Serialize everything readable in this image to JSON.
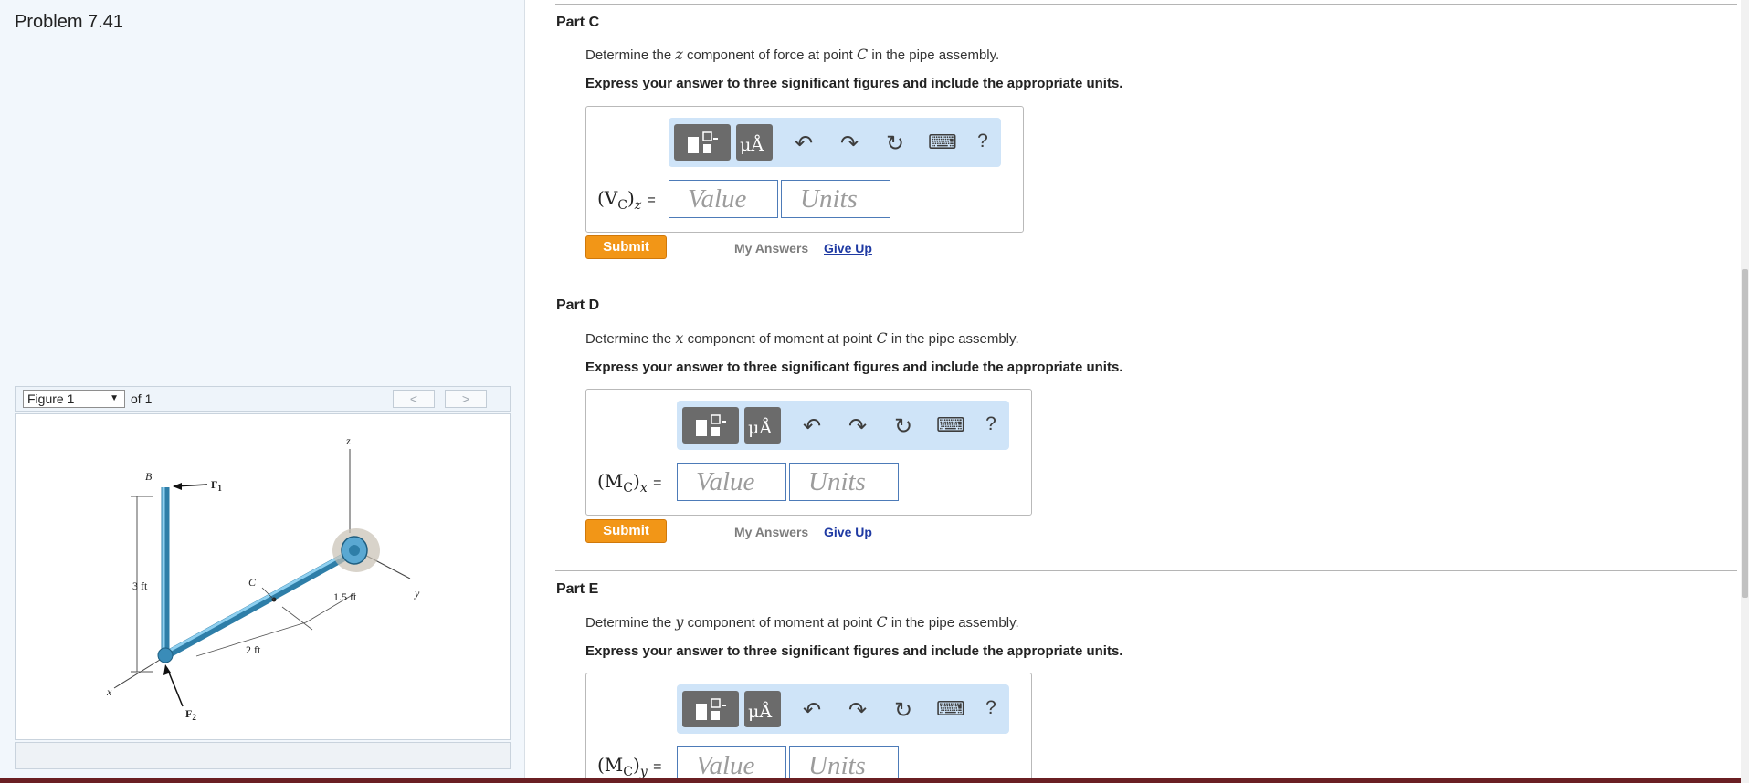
{
  "problem": {
    "title": "Problem 7.41"
  },
  "figure": {
    "selected": "Figure 1",
    "of_label": "of 1",
    "prev": "<",
    "next": ">",
    "labels": {
      "B": "B",
      "F1": "F",
      "F1_sub": "1",
      "z": "z",
      "dim_3ft": "3 ft",
      "C": "C",
      "dim_1_5ft": "1.5 ft",
      "y": "y",
      "dim_2ft": "2 ft",
      "x": "x",
      "F2": "F",
      "F2_sub": "2"
    }
  },
  "toolbar": {
    "units_symbol": "μÅ",
    "undo": "↶",
    "redo": "↷",
    "reset": "↻",
    "keyboard": "⌨",
    "help": "?"
  },
  "parts": [
    {
      "title": "Part C",
      "question_pre": "Determine the",
      "question_var": "z",
      "question_mid": "component of force at point",
      "question_point": "C",
      "question_post": "in the pipe assembly.",
      "instruction": "Express your answer to three significant figures and include the appropriate units.",
      "label_main": "(V",
      "label_sub": "C",
      "label_close": ")",
      "label_axis": "z",
      "label_eq": "=",
      "value_placeholder": "Value",
      "units_placeholder": "Units",
      "submit": "Submit",
      "my_answers": "My Answers",
      "give_up": "Give Up"
    },
    {
      "title": "Part D",
      "question_pre": "Determine the",
      "question_var": "x",
      "question_mid": "component of moment at point",
      "question_point": "C",
      "question_post": "in the pipe assembly.",
      "instruction": "Express your answer to three significant figures and include the appropriate units.",
      "label_main": "(M",
      "label_sub": "C",
      "label_close": ")",
      "label_axis": "x",
      "label_eq": "=",
      "value_placeholder": "Value",
      "units_placeholder": "Units",
      "submit": "Submit",
      "my_answers": "My Answers",
      "give_up": "Give Up"
    },
    {
      "title": "Part E",
      "question_pre": "Determine the",
      "question_var": "y",
      "question_mid": "component of moment at point",
      "question_point": "C",
      "question_post": "in the pipe assembly.",
      "instruction": "Express your answer to three significant figures and include the appropriate units.",
      "label_main": "(M",
      "label_sub": "C",
      "label_close": ")",
      "label_axis": "y",
      "label_eq": "=",
      "value_placeholder": "Value",
      "units_placeholder": "Units"
    }
  ]
}
